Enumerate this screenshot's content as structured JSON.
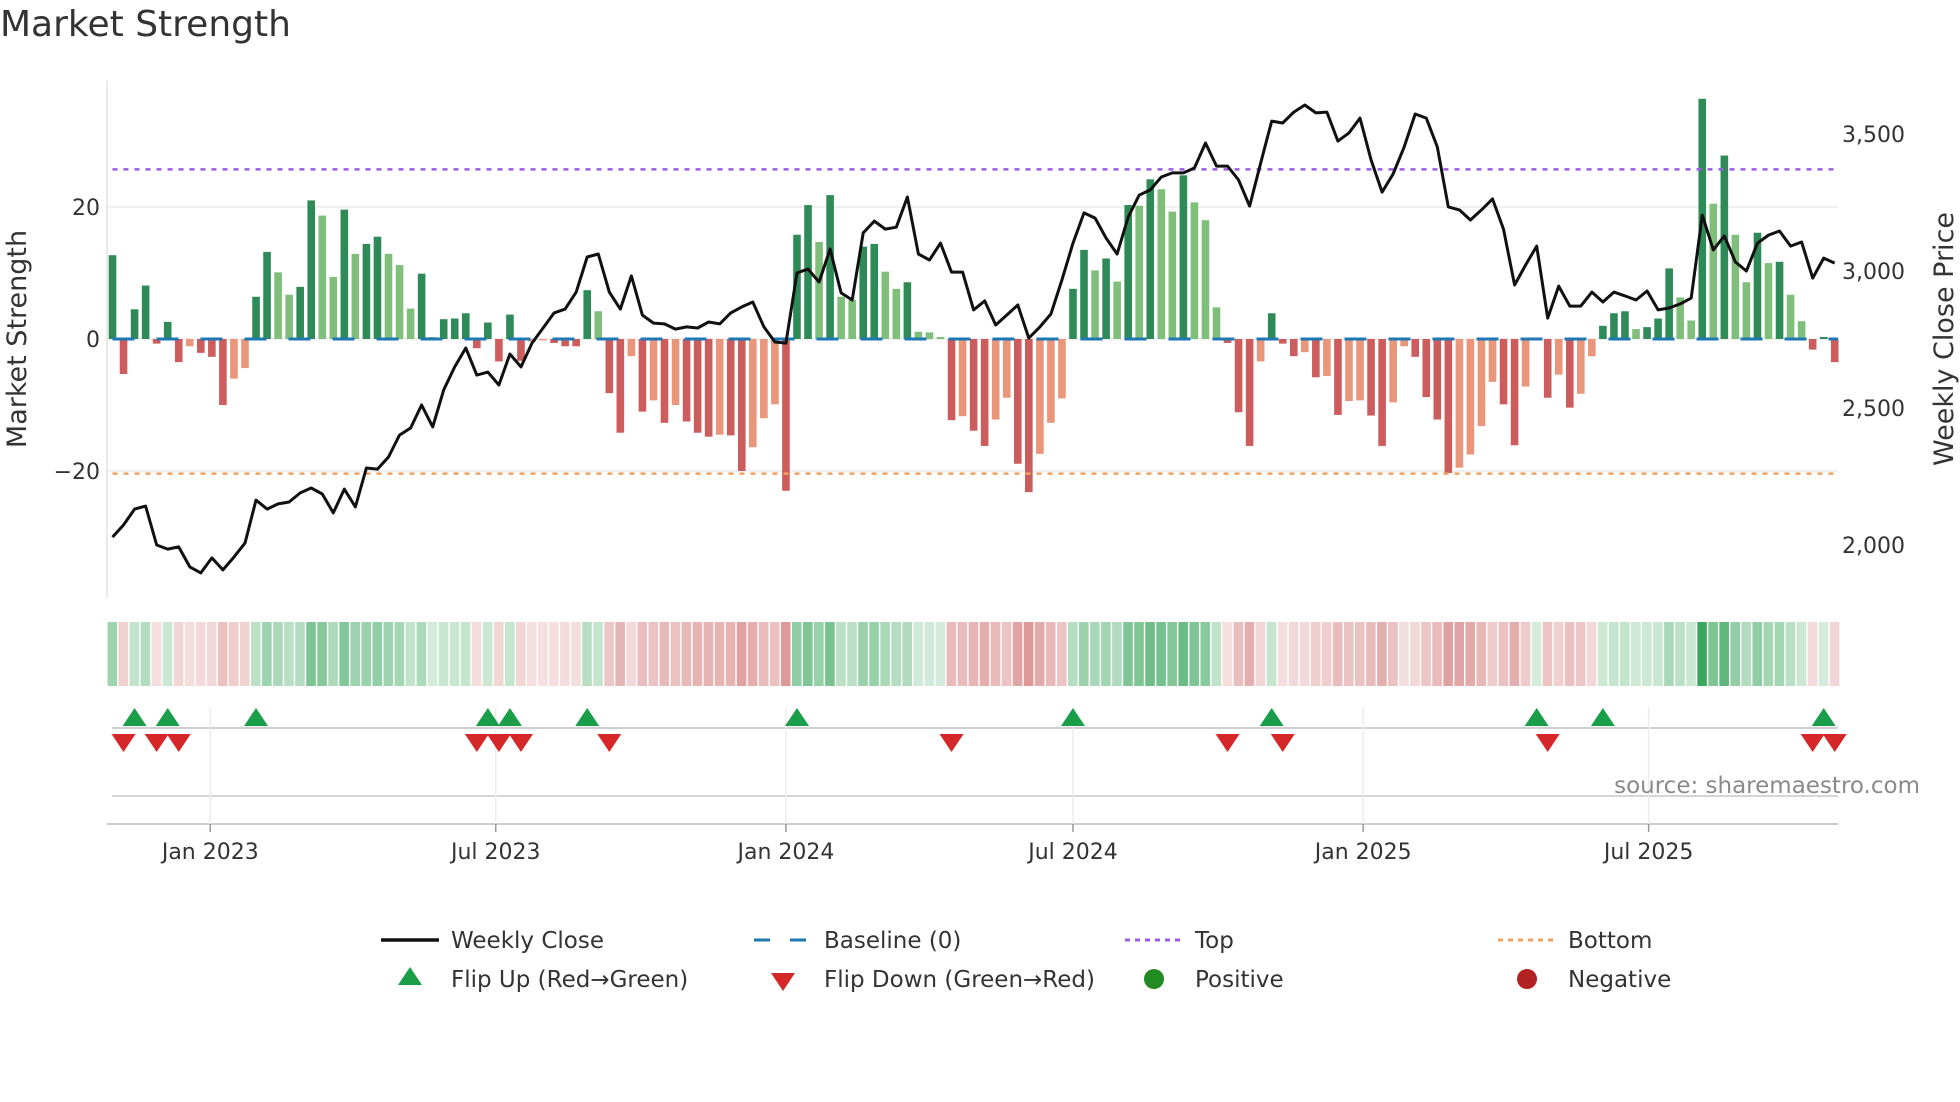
{
  "title": "Market Strength",
  "source": "source: sharemaestro.com",
  "chart_data": {
    "type": "bar",
    "title": "Market Strength",
    "ylabel": "Market Strength",
    "y2label": "Weekly Close Price",
    "ylim": [
      -39,
      39
    ],
    "y2lim": [
      1810,
      3693
    ],
    "yticks": [
      {
        "v": 20,
        "label": "20"
      },
      {
        "v": 0,
        "label": "0"
      },
      {
        "v": -20,
        "label": "−20"
      }
    ],
    "y2ticks": [
      {
        "v": 3500,
        "label": "3,500"
      },
      {
        "v": 3000,
        "label": "3,000"
      },
      {
        "v": 2500,
        "label": "2,500"
      },
      {
        "v": 2000,
        "label": "2,000"
      }
    ],
    "xticks": [
      {
        "date": "2023-01-01",
        "label": "Jan 2023"
      },
      {
        "date": "2023-07-01",
        "label": "Jul 2023"
      },
      {
        "date": "2024-01-01",
        "label": "Jan 2024"
      },
      {
        "date": "2024-07-01",
        "label": "Jul 2024"
      },
      {
        "date": "2025-01-01",
        "label": "Jan 2025"
      },
      {
        "date": "2025-07-01",
        "label": "Jul 2025"
      }
    ],
    "x_start": "2022-10-31",
    "x_step_days": 7,
    "top_level": 25.7,
    "bottom_level": -20.4,
    "baseline": 0,
    "strength": [
      12.7,
      -5.3,
      4.5,
      8.1,
      -0.7,
      2.6,
      -3.5,
      -1.1,
      -2.1,
      -2.7,
      -10,
      -6,
      -4.4,
      6.4,
      13.2,
      10.1,
      6.7,
      7.9,
      21,
      18.7,
      9.4,
      19.6,
      12.9,
      14.4,
      15.5,
      12.9,
      11.2,
      4.6,
      9.9,
      0.3,
      3,
      3.1,
      3.9,
      -1.4,
      2.5,
      -3.4,
      3.7,
      -3.3,
      -0.4,
      -0.2,
      -0.6,
      -1.1,
      -1.1,
      7.4,
      4.2,
      -8.2,
      -14.2,
      -2.6,
      -11,
      -9.3,
      -12.7,
      -10,
      -12.5,
      -14.2,
      -14.8,
      -14.5,
      -14.6,
      -20,
      -16.4,
      -12,
      -9.9,
      -23,
      15.8,
      20.3,
      14.7,
      21.8,
      6.4,
      5.9,
      14,
      14.4,
      10.2,
      7.6,
      8.6,
      1.1,
      1,
      0.3,
      -12.3,
      -11.7,
      -13.9,
      -16.2,
      -12.2,
      -8.9,
      -18.9,
      -23.2,
      -17.4,
      -12.7,
      -9,
      7.6,
      13.5,
      10.4,
      12.2,
      8.7,
      20.3,
      20.2,
      24.2,
      22.7,
      19.3,
      24.8,
      20.7,
      18,
      4.8,
      -0.6,
      -11.1,
      -16.2,
      -3.4,
      3.9,
      -0.7,
      -2.6,
      -2,
      -5.8,
      -5.6,
      -11.5,
      -9.4,
      -9.3,
      -11.6,
      -16.2,
      -9.6,
      -1.1,
      -2.7,
      -8.8,
      -12.2,
      -20.3,
      -19.5,
      -17.5,
      -13.2,
      -6.5,
      -9.9,
      -16.1,
      -7.2,
      0.2,
      -8.9,
      -5.4,
      -10.4,
      -8.3,
      -2.6,
      2,
      3.9,
      4.2,
      1.5,
      1.8,
      3.1,
      10.7,
      6.3,
      2.8,
      36.4,
      20.5,
      27.8,
      15.8,
      8.6,
      16.1,
      11.5,
      11.7,
      6.7,
      2.7,
      -1.6,
      0.3,
      -3.5
    ],
    "weekly_close": [
      2029,
      2073,
      2131,
      2142,
      2000,
      1985,
      1993,
      1920,
      1898,
      1953,
      1909,
      1956,
      2007,
      2164,
      2131,
      2150,
      2157,
      2190,
      2208,
      2186,
      2117,
      2204,
      2139,
      2281,
      2277,
      2321,
      2401,
      2427,
      2511,
      2431,
      2566,
      2650,
      2719,
      2620,
      2631,
      2584,
      2697,
      2650,
      2737,
      2792,
      2847,
      2861,
      2923,
      3051,
      3062,
      2923,
      2861,
      2982,
      2839,
      2810,
      2807,
      2788,
      2796,
      2792,
      2814,
      2807,
      2847,
      2869,
      2887,
      2796,
      2741,
      2737,
      2993,
      3007,
      2960,
      3080,
      2920,
      2894,
      3139,
      3182,
      3153,
      3160,
      3270,
      3062,
      3040,
      3102,
      2996,
      2996,
      2858,
      2891,
      2803,
      2839,
      2876,
      2755,
      2796,
      2843,
      2967,
      3102,
      3212,
      3193,
      3120,
      3062,
      3197,
      3277,
      3296,
      3343,
      3358,
      3358,
      3376,
      3467,
      3383,
      3383,
      3332,
      3237,
      3394,
      3547,
      3540,
      3580,
      3606,
      3577,
      3580,
      3474,
      3504,
      3558,
      3405,
      3288,
      3354,
      3453,
      3573,
      3558,
      3453,
      3234,
      3223,
      3186,
      3223,
      3263,
      3153,
      2949,
      3022,
      3091,
      2828,
      2945,
      2872,
      2872,
      2923,
      2887,
      2923,
      2909,
      2894,
      2927,
      2858,
      2865,
      2880,
      2901,
      3204,
      3077,
      3128,
      3033,
      3000,
      3102,
      3131,
      3146,
      3091,
      3106,
      2974,
      3047,
      3029
    ],
    "legend": [
      {
        "key": "close",
        "label": "Weekly Close"
      },
      {
        "key": "baseline",
        "label": "Baseline (0)"
      },
      {
        "key": "top",
        "label": "Top"
      },
      {
        "key": "bottom",
        "label": "Bottom"
      },
      {
        "key": "flipup",
        "label": "Flip Up (Red→Green)"
      },
      {
        "key": "flipdown",
        "label": "Flip Down (Green→Red)"
      },
      {
        "key": "positive",
        "label": "Positive"
      },
      {
        "key": "negative",
        "label": "Negative"
      }
    ],
    "legend_placement": "bottom",
    "colors": {
      "pos_strong": "#2e8b57",
      "pos_weak": "#7fbf7b",
      "neg_strong": "#cd5c5c",
      "neg_weak": "#e9967a",
      "close": "#111111",
      "baseline": "#1f77b4",
      "top": "#9b5de5",
      "bottom": "#f4a261",
      "flipup": "#1a9e4a",
      "flipdown": "#d62728",
      "positive": "#228b22",
      "negative": "#b22222"
    }
  }
}
